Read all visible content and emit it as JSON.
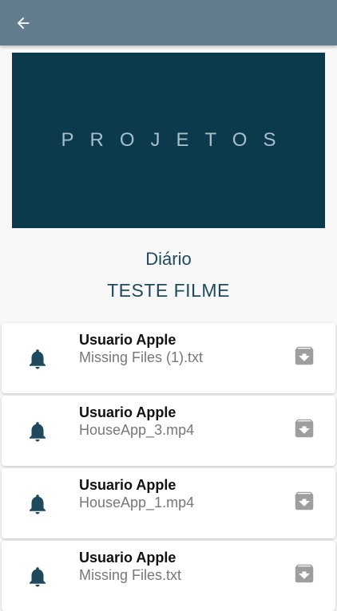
{
  "header": {
    "back_icon": "arrow-left-icon"
  },
  "banner": {
    "text": "PROJETOS"
  },
  "section": {
    "title": "Diário",
    "project": "TESTE FILME"
  },
  "items": [
    {
      "user": "Usuario Apple",
      "file": "Missing Files (1).txt"
    },
    {
      "user": "Usuario Apple",
      "file": "HouseApp_3.mp4"
    },
    {
      "user": "Usuario Apple",
      "file": "HouseApp_1.mp4"
    },
    {
      "user": "Usuario Apple",
      "file": "Missing Files.txt"
    }
  ],
  "colors": {
    "appbar": "#627d8d",
    "banner": "#0a3a4c",
    "accent": "#1f4a5e",
    "icon_gray": "#9e9e9e"
  }
}
